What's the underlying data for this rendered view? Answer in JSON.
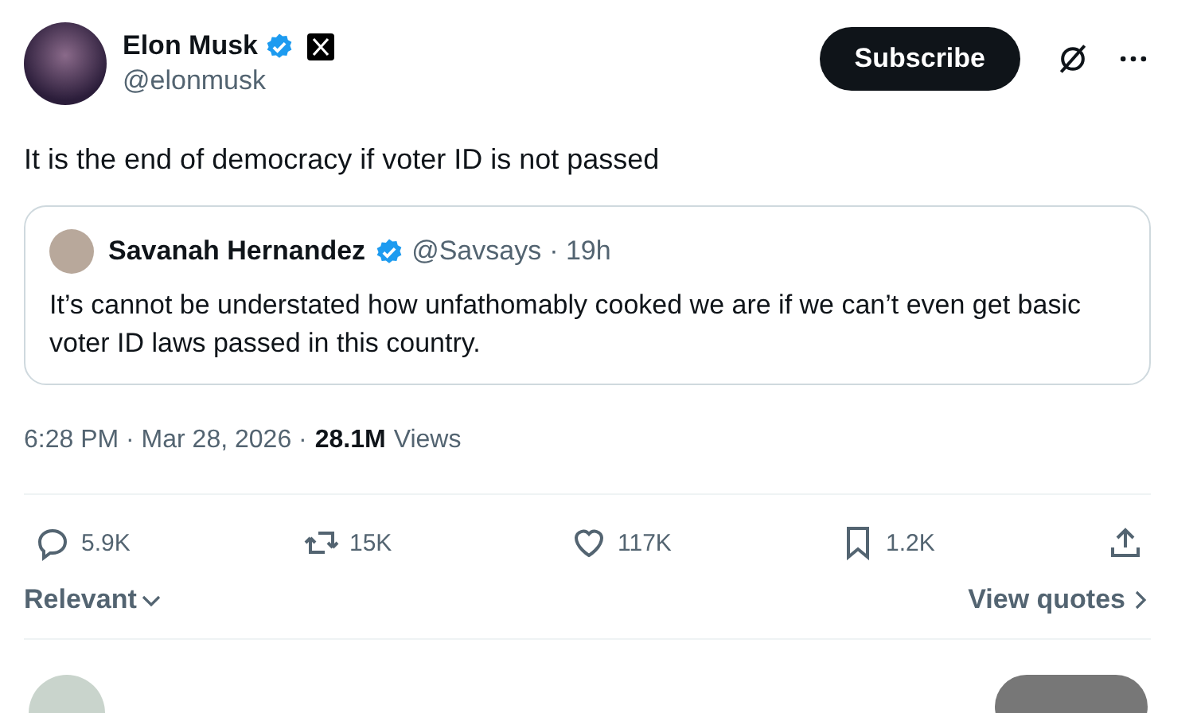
{
  "author": {
    "name": "Elon Musk",
    "handle": "@elonmusk",
    "verified": true
  },
  "subscribe": {
    "label": "Subscribe"
  },
  "text": "It is the end of democracy if voter ID is not passed",
  "quote": {
    "name": "Savanah Hernandez",
    "verified": true,
    "handle": "@Savsays",
    "time": "· 19h",
    "text": "It’s cannot be understated how unfathomably cooked we are if we can’t even get basic voter ID laws passed in this country."
  },
  "meta": {
    "timestamp": "6:28 PM · Mar 28, 2026 ·",
    "views": "28.1M",
    "views_label": "Views"
  },
  "actions": [
    {
      "kind": "reply",
      "count": "5.9K"
    },
    {
      "kind": "repost",
      "count": "15K"
    },
    {
      "kind": "like",
      "count": "117K"
    },
    {
      "kind": "bookmark",
      "count": "1.2K"
    },
    {
      "kind": "share"
    }
  ],
  "replies_sort": {
    "label": "Relevant"
  },
  "view_quotes": {
    "label": "View quotes"
  }
}
